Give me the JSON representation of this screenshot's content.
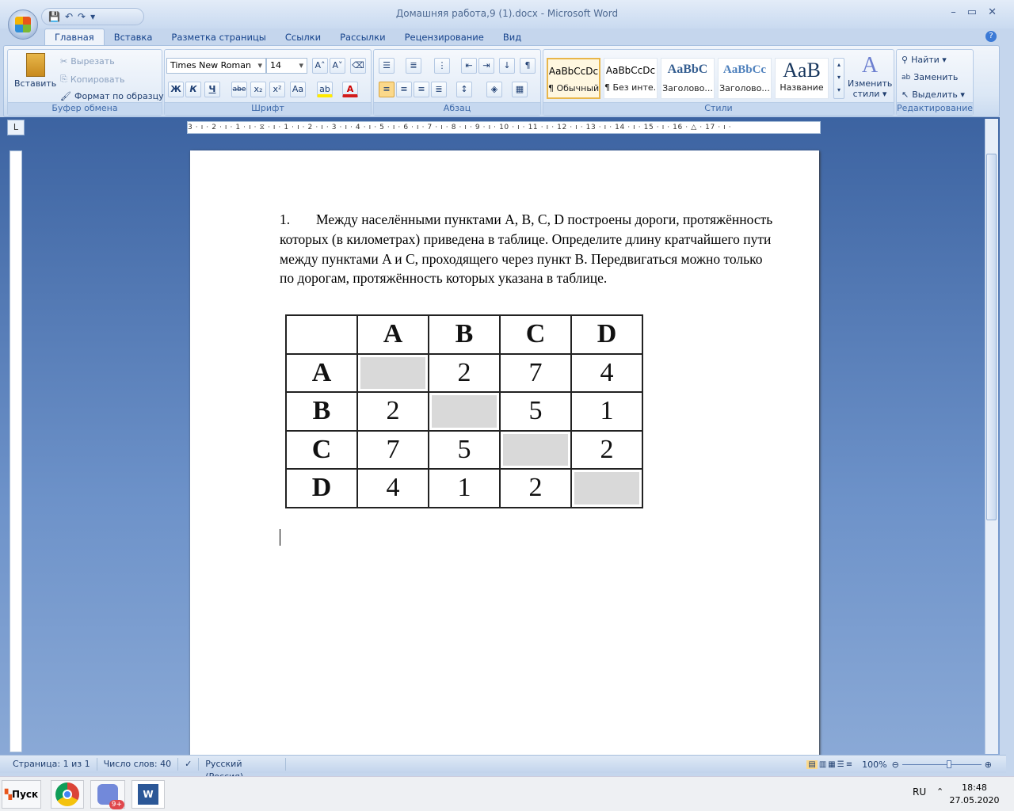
{
  "window": {
    "title": "Домашняя работа,9 (1).docx - Microsoft Word",
    "minimize": "–",
    "maximize": "▭",
    "close": "✕"
  },
  "qat": {
    "save": "💾",
    "undo": "↶",
    "redo": "↷",
    "customize": "▾"
  },
  "tabs": [
    "Главная",
    "Вставка",
    "Разметка страницы",
    "Ссылки",
    "Рассылки",
    "Рецензирование",
    "Вид"
  ],
  "clipboard": {
    "paste": "Вставить",
    "cut": "Вырезать",
    "copy": "Копировать",
    "format_painter": "Формат по образцу",
    "label": "Буфер обмена"
  },
  "font": {
    "name": "Times New Roman",
    "size": "14",
    "label": "Шрифт",
    "bold": "Ж",
    "italic": "К",
    "underline": "Ч",
    "strike": "abe",
    "sub": "x₂",
    "sup": "x²",
    "case": "Aa",
    "grow": "A˄",
    "shrink": "A˅"
  },
  "paragraph": {
    "label": "Абзац",
    "pilcrow": "¶"
  },
  "styles": {
    "label": "Стили",
    "items": [
      {
        "preview": "AaBbCcDc",
        "name": "¶ Обычный"
      },
      {
        "preview": "AaBbCcDc",
        "name": "¶ Без инте..."
      },
      {
        "preview": "AaBbC",
        "name": "Заголово..."
      },
      {
        "preview": "AaBbCc",
        "name": "Заголово..."
      },
      {
        "preview": "AaB",
        "name": "Название"
      }
    ],
    "change": "Изменить стили ▾"
  },
  "editing": {
    "label": "Редактирование",
    "find": "Найти ▾",
    "replace": "Заменить",
    "select": "Выделить ▾"
  },
  "ruler": {
    "ticks": "3 · ı · 2 · ı · 1 · ı · ⧖ · ı · 1 · ı · 2 · ı · 3 · ı · 4 · ı · 5 · ı · 6 · ı · 7 · ı · 8 · ı · 9 · ı · 10 · ı · 11 · ı · 12 · ı · 13 · ı · 14 · ı · 15 · ı · 16 · △ · 17 · ı ·",
    "tab_selector": "L"
  },
  "document": {
    "number": "1.",
    "text": "Между населёнными пунктами A, B, C, D построены дороги, протяжённость которых (в километрах) приведена в таблице. Определите длину кратчайшего пути между пунктами A и C, проходящего через пункт B. Передвигаться можно только по дорогам, протяжённость которых указана в таблице.",
    "table": {
      "header": [
        "",
        "A",
        "B",
        "C",
        "D"
      ],
      "rows": [
        [
          "A",
          "",
          "2",
          "7",
          "4"
        ],
        [
          "B",
          "2",
          "",
          "5",
          "1"
        ],
        [
          "C",
          "7",
          "5",
          "",
          "2"
        ],
        [
          "D",
          "4",
          "1",
          "2",
          ""
        ]
      ]
    }
  },
  "status": {
    "page": "Страница: 1 из 1",
    "words": "Число слов: 40",
    "language": "Русский (Россия)",
    "zoom": "100%"
  },
  "taskbar": {
    "start": "Пуск",
    "discord_badge": "9+",
    "lang": "RU",
    "time": "18:48",
    "date": "27.05.2020"
  }
}
